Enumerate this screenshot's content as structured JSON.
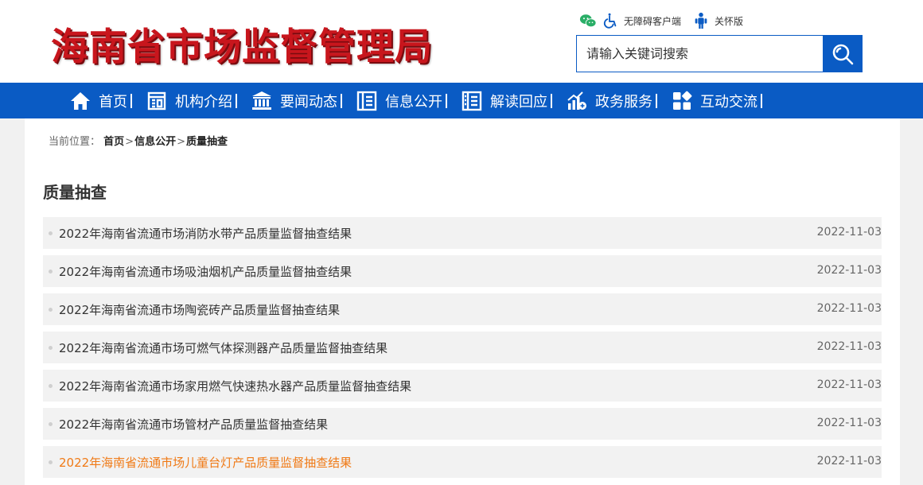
{
  "site": {
    "title": "海南省市场监督管理局"
  },
  "tools": {
    "wechat_icon": "wechat-icon",
    "accessibility_label": "无障碍客户端",
    "care_label": "关怀版"
  },
  "search": {
    "placeholder": "请输入关键词搜索"
  },
  "nav": {
    "items": [
      {
        "label": "首页",
        "icon": "home-icon"
      },
      {
        "label": "机构介绍",
        "icon": "org-icon"
      },
      {
        "label": "要闻动态",
        "icon": "building-icon"
      },
      {
        "label": "信息公开",
        "icon": "doc-list-icon"
      },
      {
        "label": "解读回应",
        "icon": "book-icon"
      },
      {
        "label": "政务服务",
        "icon": "service-chart-icon"
      },
      {
        "label": "互动交流",
        "icon": "grid-icon"
      }
    ]
  },
  "breadcrumb": {
    "prefix": "当前位置：",
    "items": [
      "首页",
      "信息公开",
      "质量抽查"
    ],
    "separator": ">"
  },
  "section": {
    "title": "质量抽查"
  },
  "list": [
    {
      "title": "2022年海南省流通市场消防水带产品质量监督抽查结果",
      "date": "2022-11-03"
    },
    {
      "title": "2022年海南省流通市场吸油烟机产品质量监督抽查结果",
      "date": "2022-11-03"
    },
    {
      "title": "2022年海南省流通市场陶瓷砖产品质量监督抽查结果",
      "date": "2022-11-03"
    },
    {
      "title": "2022年海南省流通市场可燃气体探测器产品质量监督抽查结果",
      "date": "2022-11-03"
    },
    {
      "title": "2022年海南省流通市场家用燃气快速热水器产品质量监督抽查结果",
      "date": "2022-11-03"
    },
    {
      "title": "2022年海南省流通市场管材产品质量监督抽查结果",
      "date": "2022-11-03"
    },
    {
      "title": "2022年海南省流通市场儿童台灯产品质量监督抽查结果",
      "date": "2022-11-03"
    }
  ],
  "colors": {
    "primary": "#0a5bc4",
    "logo_red": "#c8161d",
    "hover_orange": "#f07a16"
  }
}
